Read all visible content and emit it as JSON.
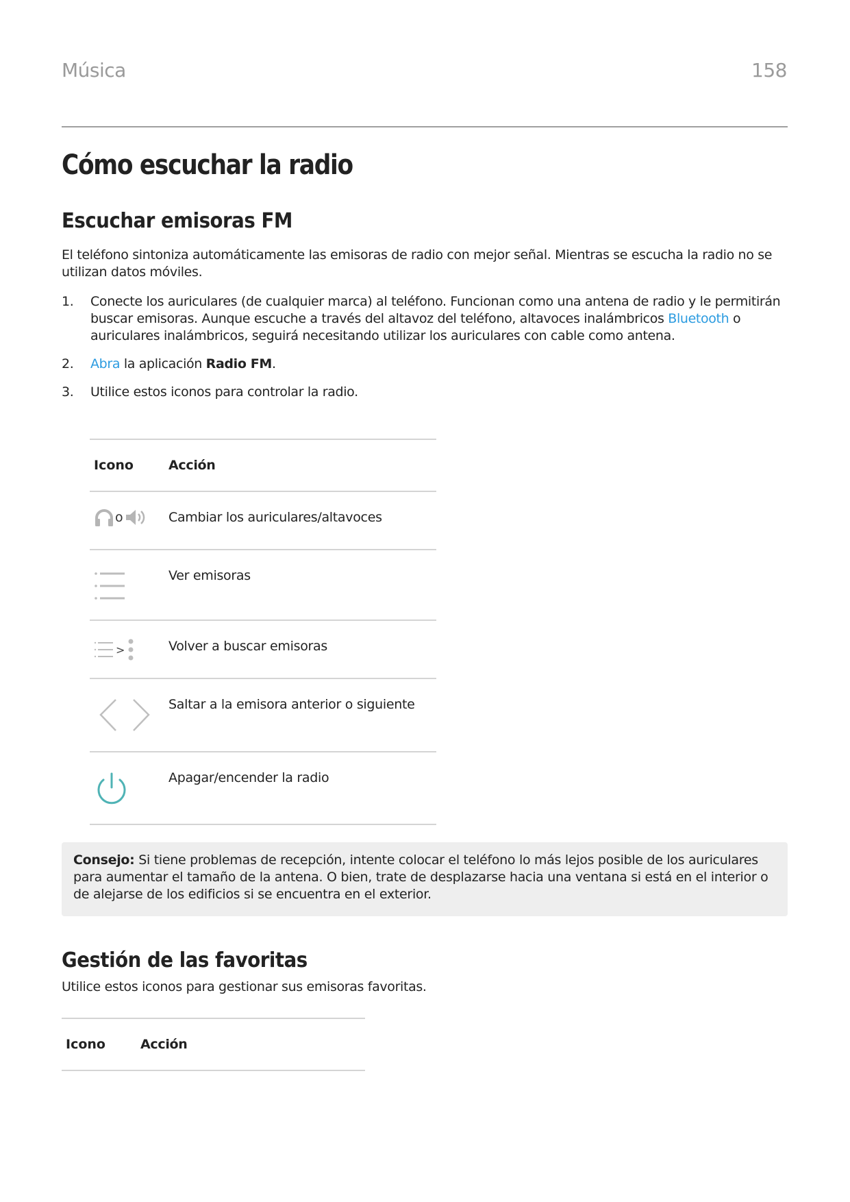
{
  "header": {
    "section": "Música",
    "page_number": "158"
  },
  "title": "Cómo escuchar la radio",
  "fm_section": {
    "heading": "Escuchar emisoras FM",
    "intro": "El teléfono sintoniza automáticamente las emisoras de radio con mejor señal. Mientras se escucha la radio no se utilizan datos móviles.",
    "steps": [
      {
        "number": "1.",
        "text_before": "Conecte los auriculares (de cualquier marca) al teléfono. Funcionan como una antena de radio y le permitirán buscar emisoras. Aunque escuche a través del altavoz del teléfono, altavoces inalámbricos ",
        "link": "Bluetooth",
        "text_after": " o auriculares inalámbricos, seguirá necesitando utilizar los auriculares con cable como antena."
      },
      {
        "number": "2.",
        "link": "Abra",
        "text_middle": " la aplicación ",
        "bold": "Radio FM",
        "text_after": "."
      },
      {
        "number": "3.",
        "text": "Utilice estos iconos para controlar la radio."
      }
    ],
    "table": {
      "headers": [
        "Icono",
        "Acción"
      ],
      "rows": [
        {
          "icon": "headphones-or-speaker-icon",
          "icon_joiner": "o",
          "action": "Cambiar los auriculares/altavoces"
        },
        {
          "icon": "list-icon",
          "action": "Ver emisoras"
        },
        {
          "icon": "rescan-icon",
          "icon_glyph": ">",
          "action": "Volver a buscar emisoras"
        },
        {
          "icon": "prev-next-icon",
          "action": "Saltar a la emisora anterior o siguiente"
        },
        {
          "icon": "power-icon",
          "action": "Apagar/encender la radio"
        }
      ]
    }
  },
  "tip": {
    "label": "Consejo:",
    "text": " Si tiene problemas de recepción, intente colocar el teléfono lo más lejos posible de los auriculares para aumentar el tamaño de la antena. O bien, trate de desplazarse hacia una ventana si está en el interior o de alejarse de los edificios si se encuentra en el exterior."
  },
  "favorites_section": {
    "heading": "Gestión de las favoritas",
    "intro": "Utilice estos iconos para gestionar sus emisoras favoritas.",
    "table": {
      "headers": [
        "Icono",
        "Acción"
      ]
    }
  },
  "colors": {
    "link": "#2b9be0",
    "icon_gray": "#b5b5b5",
    "power_teal": "#4fb3b5",
    "tip_background": "#eeeeee",
    "running_head": "#9a9a9a"
  }
}
